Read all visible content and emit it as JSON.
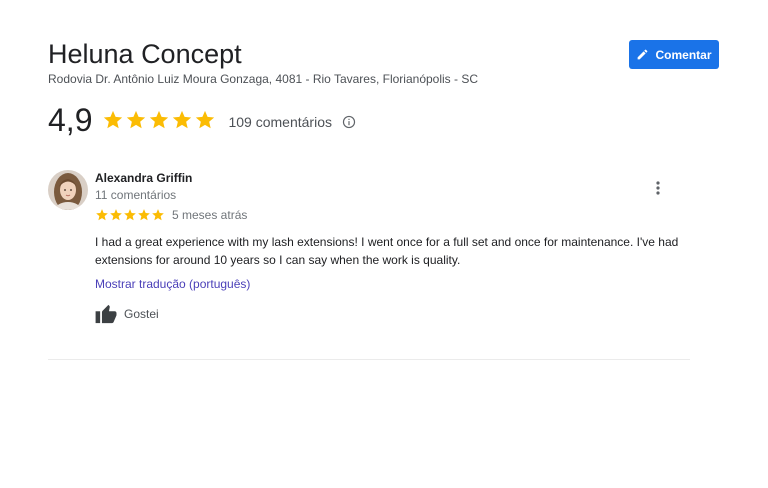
{
  "place": {
    "name": "Heluna Concept",
    "address": "Rodovia Dr. Antônio Luiz Moura Gonzaga, 4081 - Rio Tavares, Florianópolis - SC"
  },
  "header": {
    "comment_button_label": "Comentar",
    "comment_icon": "pencil-icon"
  },
  "rating": {
    "value": "4,9",
    "stars": 5,
    "count_label": "109 comentários",
    "info_icon": "info-icon",
    "star_color": "#fbbc04"
  },
  "review": {
    "reviewer_name": "Alexandra Griffin",
    "reviewer_count": "11 comentários",
    "stars": 5,
    "date": "5 meses atrás",
    "text": "I had a great experience with my lash extensions! I went once for a full set and once for maintenance. I've had extensions for around 10 years so I can say when the work is quality.",
    "translate_label": "Mostrar tradução (português)",
    "like_label": "Gostei",
    "more_icon": "more-vert-icon",
    "like_icon": "thumbs-up-icon"
  },
  "colors": {
    "accent": "#1a73e8",
    "link": "#4a3fb8",
    "star": "#fbbc04"
  }
}
